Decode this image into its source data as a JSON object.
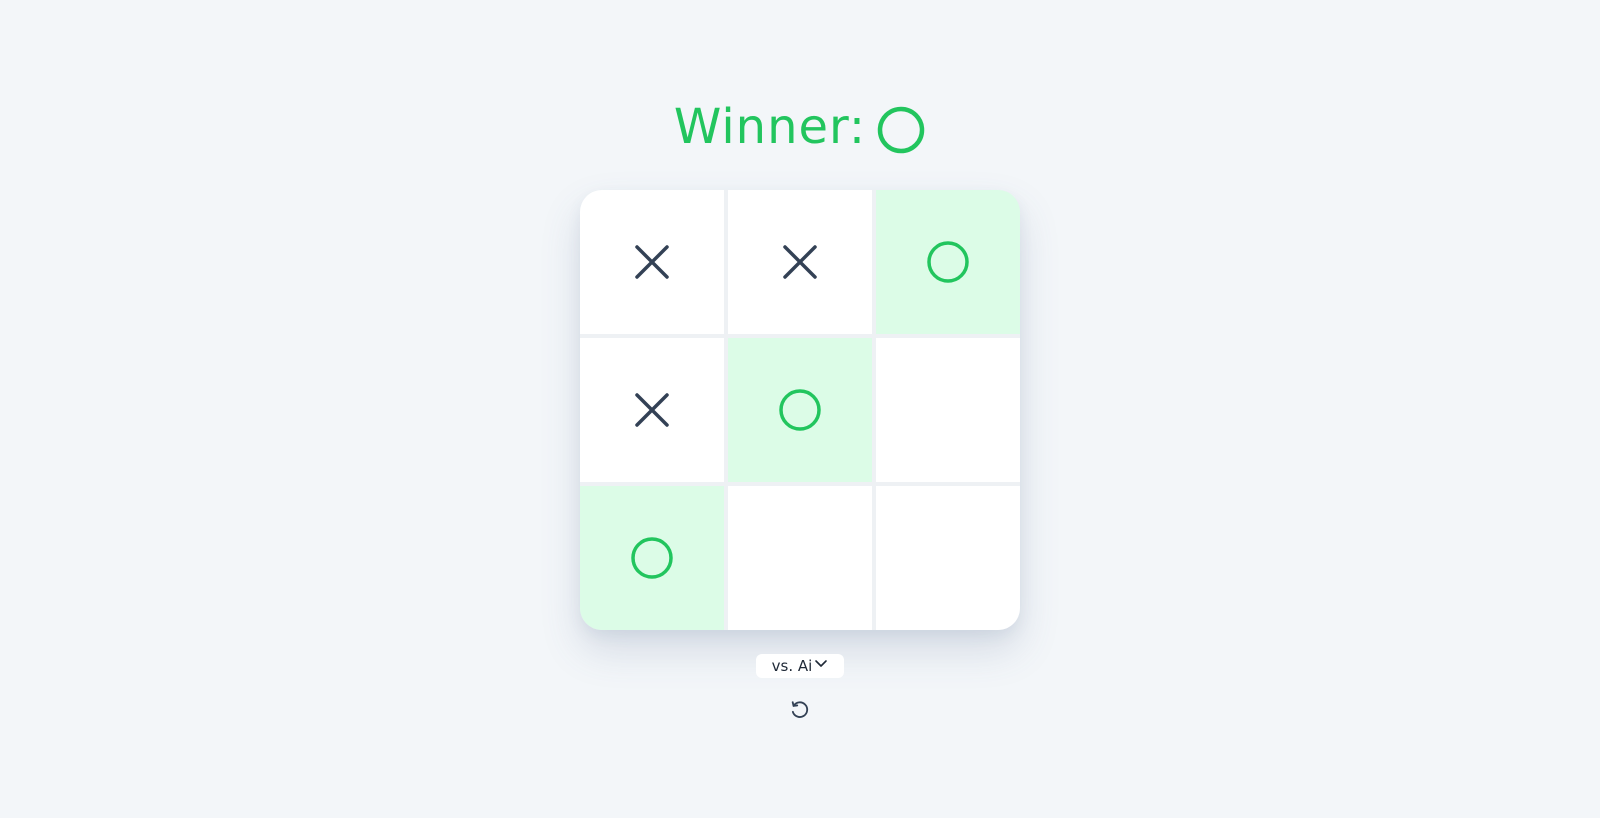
{
  "status": {
    "label": "Winner:",
    "winner_mark": "O"
  },
  "board": {
    "cells": [
      "X",
      "X",
      "O",
      "X",
      "O",
      "",
      "O",
      "",
      ""
    ],
    "winning_cells": [
      2,
      4,
      6
    ]
  },
  "controls": {
    "mode_label": "vs. Ai",
    "mode_icon": "chevron-down-icon",
    "reset_icon": "reset-icon"
  },
  "colors": {
    "accent": "#22c55e",
    "x_color": "#334155",
    "win_bg": "#dcfce7",
    "background": "#f3f6f9"
  }
}
